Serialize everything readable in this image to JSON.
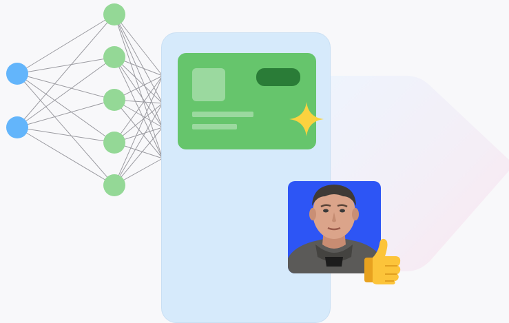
{
  "network": {
    "input_node_count": 2,
    "hidden_node_count": 5,
    "input_node_color": "#63b5fb",
    "hidden_node_color": "#94d896",
    "edge_color": "#9a9aa0"
  },
  "phone": {
    "background_color": "#d6eafb",
    "card": {
      "color": "#66c56c",
      "pill_color": "#2a7c37",
      "sparkle_color": "#fbd23f"
    }
  },
  "avatar": {
    "background_color": "#2d55f5",
    "icon": "person-photo"
  },
  "reaction": {
    "icon": "thumbs-up-icon"
  }
}
